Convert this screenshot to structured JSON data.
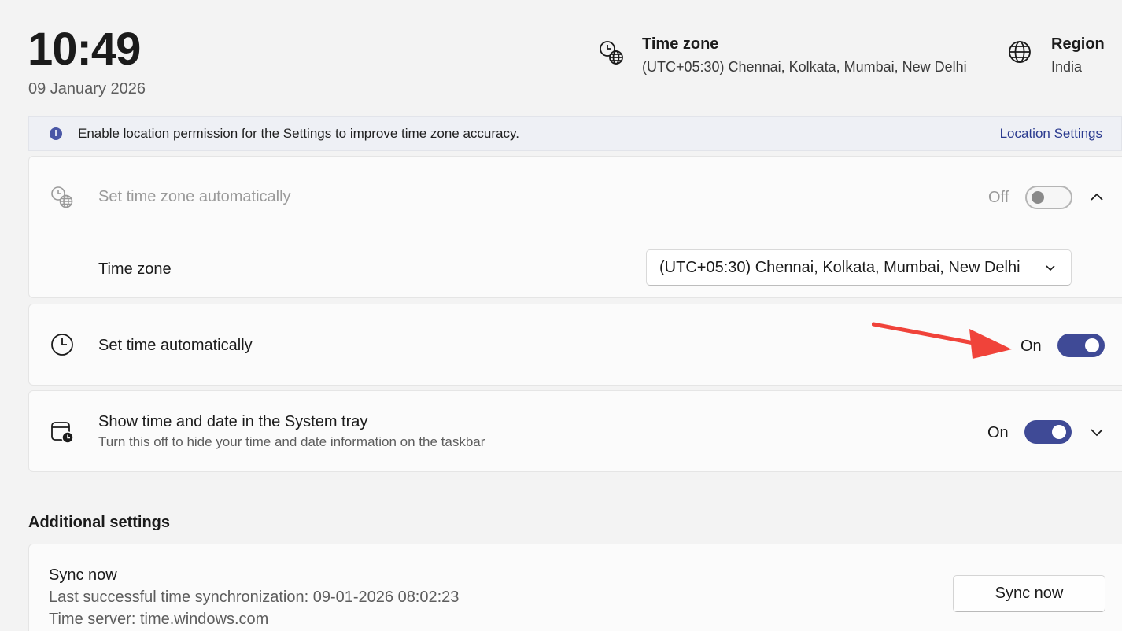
{
  "header": {
    "clock": "10:49",
    "date": "09 January 2026",
    "timezone": {
      "title": "Time zone",
      "value": "(UTC+05:30) Chennai, Kolkata, Mumbai, New Delhi",
      "icon": "clock-globe-icon"
    },
    "region": {
      "title": "Region",
      "value": "India",
      "icon": "globe-icon"
    }
  },
  "infobar": {
    "text": "Enable location permission for the Settings to improve time zone accuracy.",
    "link": "Location Settings",
    "icon": "info-icon"
  },
  "settings": {
    "auto_timezone": {
      "label": "Set time zone automatically",
      "state": "Off",
      "enabled": false
    },
    "timezone_select": {
      "label": "Time zone",
      "value": "(UTC+05:30) Chennai, Kolkata, Mumbai, New Delhi"
    },
    "auto_time": {
      "label": "Set time automatically",
      "state": "On"
    },
    "system_tray": {
      "label": "Show time and date in the System tray",
      "sub": "Turn this off to hide your time and date information on the taskbar",
      "state": "On"
    }
  },
  "additional": {
    "title": "Additional settings",
    "sync": {
      "label": "Sync now",
      "last_sync": "Last successful time synchronization: 09-01-2026 08:02:23",
      "server": "Time server: time.windows.com",
      "button": "Sync now"
    }
  },
  "colors": {
    "accent": "#3f4a96",
    "annotation_arrow": "#f0433a",
    "link": "#2a3a8f"
  }
}
